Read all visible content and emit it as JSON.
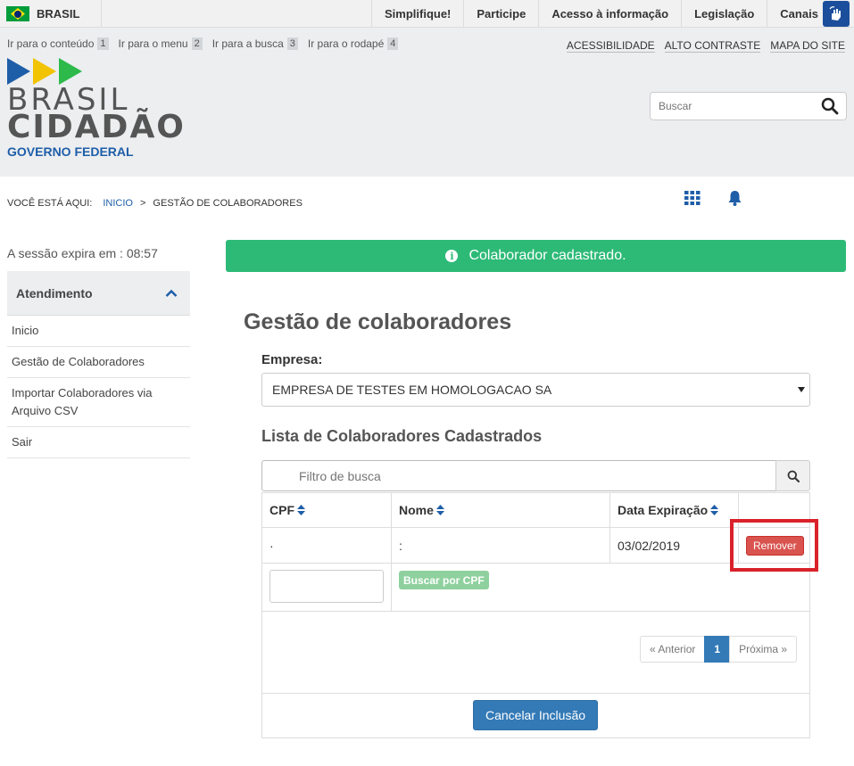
{
  "topbar": {
    "country": "BRASIL",
    "links": [
      "Simplifique!",
      "Participe",
      "Acesso à informação",
      "Legislação",
      "Canais"
    ],
    "vlibras_icon": "hand-sign-language-icon"
  },
  "header": {
    "skip_links": [
      {
        "label": "Ir para o conteúdo",
        "key": "1"
      },
      {
        "label": "Ir para o menu",
        "key": "2"
      },
      {
        "label": "Ir para a busca",
        "key": "3"
      },
      {
        "label": "Ir para o rodapé",
        "key": "4"
      }
    ],
    "accessibility_links": [
      "ACESSIBILIDADE",
      "ALTO CONTRASTE",
      "MAPA DO SITE"
    ],
    "logo": {
      "line1": "BRASIL",
      "line2": "CIDADÃO",
      "line3": "GOVERNO FEDERAL",
      "arrow_colors": [
        "#1e5ea8",
        "#f2c300",
        "#2dba4a"
      ]
    },
    "search": {
      "placeholder": "Buscar"
    }
  },
  "breadcrumb": {
    "prefix": "VOCÊ ESTÁ AQUI:",
    "home": "INICIO",
    "separator": ">",
    "current": "GESTÃO DE COLABORADORES"
  },
  "sidebar": {
    "session": "A sessão expira em : 08:57",
    "section_title": "Atendimento",
    "items": [
      "Inicio",
      "Gestão de Colaboradores",
      "Importar Colaboradores via Arquivo CSV",
      "Sair"
    ]
  },
  "main": {
    "alert": "Colaborador cadastrado.",
    "title": "Gestão de colaboradores",
    "empresa_label": "Empresa:",
    "empresa_value": "EMPRESA DE TESTES EM HOMOLOGACAO SA",
    "list_title": "Lista de Colaboradores Cadastrados",
    "filter_placeholder": "Filtro de busca",
    "table": {
      "headers": [
        "CPF",
        "Nome",
        "Data Expiração"
      ],
      "rows": [
        {
          "cpf": "·",
          "nome": ":",
          "expira": "03/02/2019",
          "action": "Remover"
        }
      ]
    },
    "cpf_search_button": "Buscar por CPF",
    "pagination": {
      "prev": "« Anterior",
      "current": "1",
      "next": "Próxima »"
    },
    "cancel_button": "Cancelar Inclusão"
  },
  "colors": {
    "accent": "#337ab7",
    "success": "#2dba77",
    "danger": "#d9534f",
    "highlight": "#d9222a"
  }
}
